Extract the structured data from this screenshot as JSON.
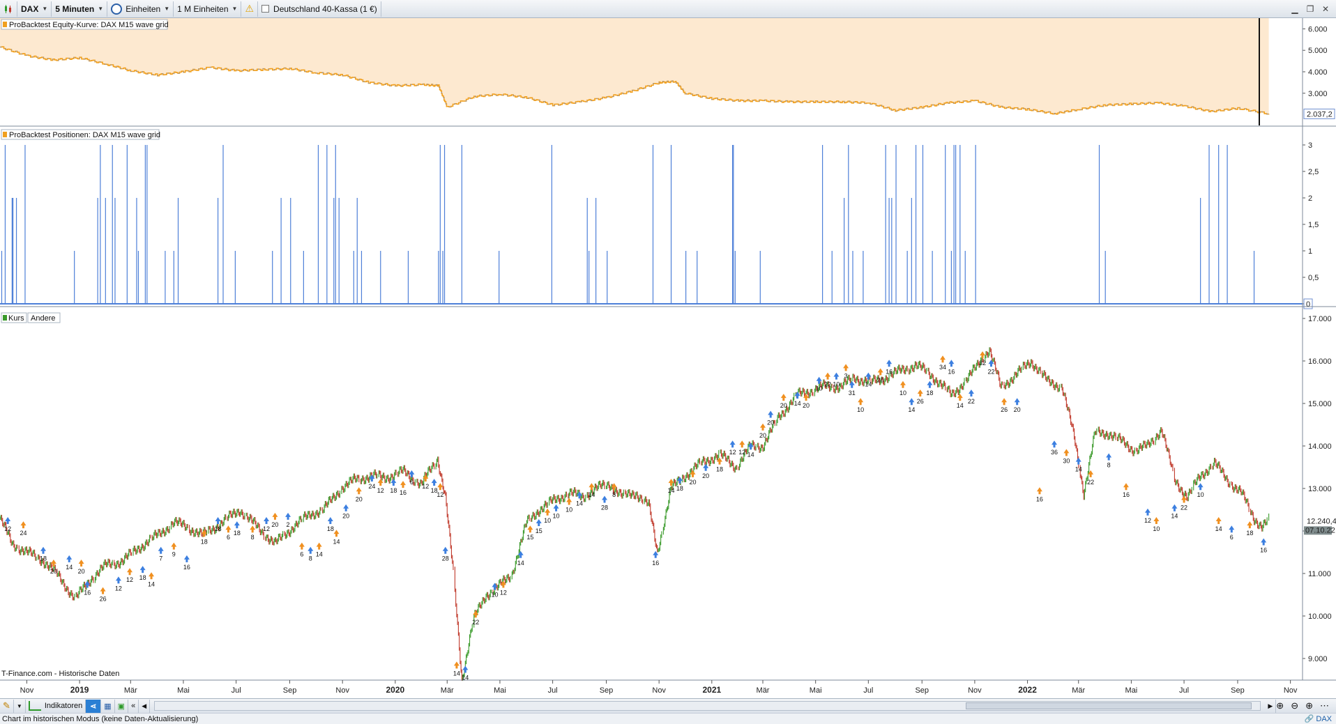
{
  "toolbar": {
    "symbol": "DAX",
    "timeframe": "5 Minuten",
    "units": "Einheiten",
    "units_count": "1 M Einheiten",
    "instrument": "Deutschland 40-Kassa (1 €)"
  },
  "panels": {
    "equity": {
      "label": "ProBacktest Equity-Kurve: DAX M15 wave grid",
      "last_value": "2.037,2"
    },
    "positions": {
      "label": "ProBacktest Positionen: DAX M15 wave grid",
      "last_value": "0"
    },
    "price": {
      "label_kurs": "Kurs",
      "label_andere": "Andere",
      "last_value": "12.240,4",
      "last_time": "07.10.22"
    }
  },
  "watermark": "T-Finance.com - Historische Daten",
  "bottom": {
    "indicators_label": "Indikatoren"
  },
  "status": {
    "text": "Chart im historischen Modus (keine Daten-Aktualisierung)",
    "right_link": "DAX"
  },
  "colors": {
    "equity_line": "#f0a020",
    "equity_fill": "#fde9d0",
    "positions": "#4d7fd8",
    "price_up": "#3a9a2a",
    "price_down": "#c0392b",
    "buy_arrow": "#3c7fe0",
    "sell_arrow": "#f09020"
  },
  "chart_data": [
    {
      "type": "area",
      "title": "ProBacktest Equity-Kurve: DAX M15 wave grid",
      "ylim": [
        1500,
        6500
      ],
      "y_ticks": [
        "6.000",
        "5.000",
        "4.000",
        "3.000"
      ],
      "y_tick_values": [
        6000,
        5000,
        4000,
        3000
      ],
      "grid": false,
      "x": [
        "2018-10-01",
        "2018-11-01",
        "2018-12-01",
        "2019-01-01",
        "2019-02-01",
        "2019-03-01",
        "2019-04-01",
        "2019-05-01",
        "2019-06-01",
        "2019-07-01",
        "2019-08-01",
        "2019-09-01",
        "2019-10-01",
        "2019-11-01",
        "2019-12-01",
        "2020-01-01",
        "2020-02-01",
        "2020-02-20",
        "2020-03-01",
        "2020-04-01",
        "2020-05-01",
        "2020-06-01",
        "2020-07-01",
        "2020-08-01",
        "2020-09-01",
        "2020-10-01",
        "2020-11-01",
        "2020-11-20",
        "2020-12-01",
        "2021-01-01",
        "2021-02-01",
        "2021-03-01",
        "2021-04-01",
        "2021-05-01",
        "2021-06-01",
        "2021-07-01",
        "2021-08-01",
        "2021-09-01",
        "2021-10-01",
        "2021-11-01",
        "2021-12-01",
        "2022-01-01",
        "2022-02-01",
        "2022-03-01",
        "2022-04-01",
        "2022-05-01",
        "2022-06-01",
        "2022-07-01",
        "2022-08-01",
        "2022-09-01",
        "2022-10-07"
      ],
      "values": [
        5150,
        4750,
        4550,
        4650,
        4350,
        4050,
        3850,
        4000,
        4200,
        4050,
        4100,
        4150,
        3950,
        3850,
        3500,
        3350,
        3400,
        3350,
        2350,
        2850,
        2950,
        2800,
        2450,
        2600,
        2800,
        3100,
        3500,
        3550,
        3000,
        2750,
        2650,
        2650,
        2600,
        2600,
        2600,
        2550,
        2200,
        2350,
        2550,
        2650,
        2350,
        2250,
        2050,
        2250,
        2450,
        2500,
        2550,
        2400,
        2150,
        2300,
        2037.2
      ]
    },
    {
      "type": "bar",
      "title": "ProBacktest Positionen: DAX M15 wave grid",
      "ylim": [
        0,
        3
      ],
      "y_ticks": [
        "3",
        "2,5",
        "2",
        "1,5",
        "1",
        "0,5",
        "0"
      ],
      "y_tick_values": [
        3,
        2.5,
        2,
        1.5,
        1,
        0.5,
        0
      ],
      "x": [
        "2018-10-03",
        "2018-10-07",
        "2018-10-15",
        "2018-10-16",
        "2018-10-20",
        "2018-10-30",
        "2018-12-26",
        "2019-01-22",
        "2019-01-25",
        "2019-01-31",
        "2019-02-08",
        "2019-02-11",
        "2019-02-25",
        "2019-03-08",
        "2019-03-10",
        "2019-03-18",
        "2019-03-20",
        "2019-04-10",
        "2019-04-20",
        "2019-04-25",
        "2019-06-10",
        "2019-06-16",
        "2019-06-30",
        "2019-08-12",
        "2019-08-22",
        "2019-09-02",
        "2019-09-17",
        "2019-10-04",
        "2019-10-14",
        "2019-10-22",
        "2019-10-24",
        "2019-10-28",
        "2019-11-14",
        "2019-11-18",
        "2019-11-23",
        "2019-12-15",
        "2020-01-16",
        "2020-02-20",
        "2020-02-22",
        "2020-02-25",
        "2020-02-27",
        "2020-03-18",
        "2020-04-30",
        "2020-06-30",
        "2020-08-10",
        "2020-08-12",
        "2020-08-20",
        "2020-09-02",
        "2020-10-25",
        "2020-11-15",
        "2020-12-02",
        "2020-12-15",
        "2021-01-25",
        "2021-01-26",
        "2021-01-28",
        "2021-02-26",
        "2021-05-09",
        "2021-05-20",
        "2021-06-03",
        "2021-06-08",
        "2021-06-13",
        "2021-06-25",
        "2021-07-21",
        "2021-07-25",
        "2021-07-28",
        "2021-08-02",
        "2021-08-15",
        "2021-08-20",
        "2021-08-25",
        "2021-09-02",
        "2021-09-13",
        "2021-09-28",
        "2021-10-05",
        "2021-10-08",
        "2021-10-10",
        "2021-10-15",
        "2021-10-21",
        "2021-11-02",
        "2022-03-25",
        "2022-04-01",
        "2022-07-20",
        "2022-07-30",
        "2022-08-10",
        "2022-08-20",
        "2022-09-20"
      ],
      "values": [
        1,
        3,
        2,
        2,
        2,
        3,
        1,
        2,
        3,
        2,
        3,
        2,
        3,
        2,
        1,
        3,
        3,
        1,
        1,
        2,
        2,
        3,
        1,
        1,
        2,
        2,
        1,
        3,
        3,
        2,
        3,
        2,
        1,
        2,
        1,
        1,
        1,
        1,
        3,
        1,
        3,
        3,
        1,
        3,
        2,
        1,
        2,
        1,
        3,
        3,
        1,
        1,
        3,
        3,
        1,
        1,
        3,
        1,
        2,
        3,
        1,
        1,
        3,
        2,
        2,
        3,
        1,
        2,
        3,
        3,
        1,
        3,
        1,
        3,
        3,
        3,
        1,
        3,
        3,
        1,
        2,
        3,
        3,
        3,
        1
      ]
    },
    {
      "type": "line",
      "title": "Kurs",
      "ylim": [
        8000,
        17000
      ],
      "y_ticks": [
        "17.000",
        "16.000",
        "15.000",
        "14.000",
        "13.000",
        "12.000",
        "11.000",
        "10.000",
        "9.000"
      ],
      "y_tick_values": [
        17000,
        16000,
        15000,
        14000,
        13000,
        12000,
        11000,
        10000,
        9000
      ],
      "x_ticks": [
        "Nov",
        "2019",
        "Mär",
        "Mai",
        "Jul",
        "Sep",
        "Nov",
        "2020",
        "Mär",
        "Mai",
        "Jul",
        "Sep",
        "Nov",
        "2021",
        "Mär",
        "Mai",
        "Jul",
        "Sep",
        "Nov",
        "2022",
        "Mär",
        "Mai",
        "Jul",
        "Sep",
        "Nov"
      ],
      "x_tick_dates": [
        "2018-11-01",
        "2019-01-01",
        "2019-03-01",
        "2019-05-01",
        "2019-07-01",
        "2019-09-01",
        "2019-11-01",
        "2020-01-01",
        "2020-03-01",
        "2020-05-01",
        "2020-07-01",
        "2020-09-01",
        "2020-11-01",
        "2021-01-01",
        "2021-03-01",
        "2021-05-01",
        "2021-07-01",
        "2021-09-01",
        "2021-11-01",
        "2022-01-01",
        "2022-03-01",
        "2022-05-01",
        "2022-07-01",
        "2022-09-01",
        "2022-11-01"
      ],
      "x": [
        "2018-10-01",
        "2018-10-15",
        "2018-11-01",
        "2018-11-20",
        "2018-12-05",
        "2018-12-27",
        "2019-01-15",
        "2019-02-01",
        "2019-02-20",
        "2019-03-10",
        "2019-04-01",
        "2019-04-20",
        "2019-05-05",
        "2019-05-23",
        "2019-06-15",
        "2019-07-05",
        "2019-07-25",
        "2019-08-15",
        "2019-09-05",
        "2019-09-25",
        "2019-10-10",
        "2019-10-30",
        "2019-11-15",
        "2019-12-05",
        "2019-12-20",
        "2020-01-10",
        "2020-01-31",
        "2020-02-19",
        "2020-02-28",
        "2020-03-09",
        "2020-03-18",
        "2020-03-31",
        "2020-04-15",
        "2020-04-30",
        "2020-05-15",
        "2020-06-01",
        "2020-06-15",
        "2020-07-01",
        "2020-07-20",
        "2020-08-05",
        "2020-08-20",
        "2020-09-05",
        "2020-09-20",
        "2020-10-05",
        "2020-10-20",
        "2020-10-30",
        "2020-11-15",
        "2020-12-01",
        "2020-12-20",
        "2021-01-10",
        "2021-01-29",
        "2021-02-15",
        "2021-03-01",
        "2021-03-20",
        "2021-04-10",
        "2021-04-25",
        "2021-05-10",
        "2021-05-30",
        "2021-06-15",
        "2021-07-05",
        "2021-07-20",
        "2021-08-10",
        "2021-08-25",
        "2021-09-10",
        "2021-09-25",
        "2021-10-05",
        "2021-10-25",
        "2021-11-10",
        "2021-11-18",
        "2021-12-01",
        "2021-12-15",
        "2022-01-05",
        "2022-01-25",
        "2022-02-10",
        "2022-02-24",
        "2022-03-07",
        "2022-03-20",
        "2022-04-05",
        "2022-04-20",
        "2022-05-05",
        "2022-05-20",
        "2022-06-05",
        "2022-06-20",
        "2022-07-05",
        "2022-07-20",
        "2022-08-05",
        "2022-08-20",
        "2022-09-05",
        "2022-09-20",
        "2022-09-29",
        "2022-10-07"
      ],
      "values": [
        12300,
        11700,
        11500,
        11300,
        11000,
        10400,
        10900,
        11200,
        11300,
        11600,
        11900,
        12200,
        12100,
        11900,
        12200,
        12500,
        12100,
        11700,
        12100,
        12400,
        12500,
        13000,
        13200,
        13300,
        13250,
        13400,
        13100,
        13700,
        12800,
        10800,
        8500,
        9900,
        10500,
        10700,
        11000,
        12200,
        12500,
        12700,
        12900,
        12800,
        13000,
        13100,
        12800,
        12900,
        12600,
        11500,
        13000,
        13300,
        13600,
        13800,
        13500,
        14000,
        14000,
        14700,
        15200,
        15300,
        15400,
        15400,
        15600,
        15500,
        15600,
        15800,
        15900,
        15700,
        15400,
        15200,
        15600,
        16100,
        16250,
        15400,
        15600,
        16000,
        15500,
        15400,
        14200,
        12900,
        14300,
        14300,
        14100,
        13900,
        14000,
        14400,
        13200,
        12800,
        13300,
        13600,
        13200,
        12900,
        12300,
        12100,
        12240.4
      ],
      "annotations": [
        [
          "2018-10-10",
          12000,
          "12"
        ],
        [
          "2018-10-28",
          11900,
          "24"
        ],
        [
          "2018-11-20",
          11300,
          "18"
        ],
        [
          "2018-12-02",
          11000,
          "20"
        ],
        [
          "2018-12-20",
          11100,
          "14"
        ],
        [
          "2019-01-03",
          11000,
          "20"
        ],
        [
          "2019-01-10",
          10500,
          "16"
        ],
        [
          "2019-01-28",
          10350,
          "26"
        ],
        [
          "2019-02-15",
          10600,
          "12"
        ],
        [
          "2019-02-28",
          10800,
          "12"
        ],
        [
          "2019-03-15",
          10850,
          "18"
        ],
        [
          "2019-03-25",
          10700,
          "14"
        ],
        [
          "2019-04-05",
          11300,
          "7"
        ],
        [
          "2019-04-20",
          11400,
          "9"
        ],
        [
          "2019-05-05",
          11100,
          "16"
        ],
        [
          "2019-05-25",
          11700,
          "18"
        ],
        [
          "2019-06-10",
          12000,
          "18"
        ],
        [
          "2019-06-22",
          11800,
          "6"
        ],
        [
          "2019-07-02",
          11900,
          "18"
        ],
        [
          "2019-07-20",
          11800,
          "8"
        ],
        [
          "2019-08-05",
          12000,
          "12"
        ],
        [
          "2019-08-15",
          12100,
          "20"
        ],
        [
          "2019-08-30",
          12100,
          "2"
        ],
        [
          "2019-09-15",
          11400,
          "6"
        ],
        [
          "2019-09-25",
          11300,
          "8"
        ],
        [
          "2019-10-05",
          11400,
          "14"
        ],
        [
          "2019-10-18",
          12000,
          "18"
        ],
        [
          "2019-10-25",
          11700,
          "14"
        ],
        [
          "2019-11-05",
          12300,
          "20"
        ],
        [
          "2019-11-20",
          12700,
          "20"
        ],
        [
          "2019-12-05",
          13000,
          "24"
        ],
        [
          "2019-12-15",
          12900,
          "12"
        ],
        [
          "2019-12-30",
          12900,
          "18"
        ],
        [
          "2020-01-10",
          12850,
          "16"
        ],
        [
          "2020-01-20",
          13100,
          "6"
        ],
        [
          "2020-02-05",
          13000,
          "12"
        ],
        [
          "2020-02-15",
          12900,
          "18"
        ],
        [
          "2020-02-22",
          12800,
          "12"
        ],
        [
          "2020-02-28",
          11300,
          "28"
        ],
        [
          "2020-03-12",
          8600,
          "14"
        ],
        [
          "2020-03-22",
          8500,
          "14"
        ],
        [
          "2020-04-03",
          9800,
          "22"
        ],
        [
          "2020-04-25",
          10450,
          "10"
        ],
        [
          "2020-05-05",
          10500,
          "12"
        ],
        [
          "2020-05-25",
          11200,
          "14"
        ],
        [
          "2020-06-05",
          11800,
          "15"
        ],
        [
          "2020-06-15",
          11950,
          "15"
        ],
        [
          "2020-06-25",
          12200,
          "10"
        ],
        [
          "2020-07-05",
          12300,
          "10"
        ],
        [
          "2020-07-20",
          12450,
          "10"
        ],
        [
          "2020-08-01",
          12600,
          "14"
        ],
        [
          "2020-08-15",
          12800,
          "14"
        ],
        [
          "2020-08-30",
          12500,
          "28"
        ],
        [
          "2020-09-10",
          12800,
          "8"
        ],
        [
          "2020-10-28",
          11200,
          "16"
        ],
        [
          "2020-11-15",
          12900,
          "14"
        ],
        [
          "2020-11-25",
          12950,
          "18"
        ],
        [
          "2020-12-10",
          13100,
          "20"
        ],
        [
          "2020-12-25",
          13250,
          "20"
        ],
        [
          "2021-01-10",
          13400,
          "18"
        ],
        [
          "2021-01-25",
          13800,
          "12"
        ],
        [
          "2021-02-05",
          13800,
          "12"
        ],
        [
          "2021-02-15",
          13750,
          "14"
        ],
        [
          "2021-03-01",
          14200,
          "20"
        ],
        [
          "2021-03-10",
          14500,
          "20"
        ],
        [
          "2021-03-25",
          14900,
          "20"
        ],
        [
          "2021-04-10",
          14950,
          "14"
        ],
        [
          "2021-04-20",
          14900,
          "20"
        ],
        [
          "2021-05-05",
          15300,
          "10"
        ],
        [
          "2021-05-15",
          15400,
          "22"
        ],
        [
          "2021-05-25",
          15400,
          "10"
        ],
        [
          "2021-06-05",
          15600,
          "3"
        ],
        [
          "2021-06-12",
          15200,
          "31"
        ],
        [
          "2021-06-22",
          14800,
          "10"
        ],
        [
          "2021-07-01",
          15400,
          "14"
        ],
        [
          "2021-07-15",
          15500,
          "20"
        ],
        [
          "2021-07-25",
          15700,
          "16"
        ],
        [
          "2021-08-10",
          15200,
          "10"
        ],
        [
          "2021-08-20",
          14800,
          "14"
        ],
        [
          "2021-08-30",
          15000,
          "26"
        ],
        [
          "2021-09-10",
          15200,
          "18"
        ],
        [
          "2021-09-25",
          15800,
          "34"
        ],
        [
          "2021-10-05",
          15700,
          "16"
        ],
        [
          "2021-10-15",
          14900,
          "14"
        ],
        [
          "2021-10-28",
          15000,
          "22"
        ],
        [
          "2021-11-10",
          15900,
          "32"
        ],
        [
          "2021-11-20",
          15700,
          "22"
        ],
        [
          "2021-12-05",
          14800,
          "26"
        ],
        [
          "2021-12-20",
          14800,
          "20"
        ],
        [
          "2022-01-15",
          12700,
          "16"
        ],
        [
          "2022-02-01",
          13800,
          "36"
        ],
        [
          "2022-02-15",
          13600,
          "30"
        ],
        [
          "2022-03-01",
          13400,
          "14"
        ],
        [
          "2022-03-15",
          13100,
          "22"
        ],
        [
          "2022-04-05",
          13500,
          "8"
        ],
        [
          "2022-04-25",
          12800,
          "16"
        ],
        [
          "2022-05-20",
          12200,
          "12"
        ],
        [
          "2022-05-30",
          12000,
          "10"
        ],
        [
          "2022-06-20",
          12300,
          "14"
        ],
        [
          "2022-07-01",
          12500,
          "22"
        ],
        [
          "2022-07-20",
          12800,
          "10"
        ],
        [
          "2022-08-10",
          12000,
          "14"
        ],
        [
          "2022-08-25",
          11800,
          "6"
        ],
        [
          "2022-09-15",
          11900,
          "18"
        ],
        [
          "2022-10-01",
          11500,
          "16"
        ]
      ]
    }
  ]
}
